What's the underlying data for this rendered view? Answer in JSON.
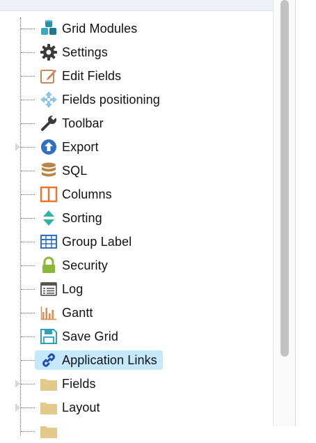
{
  "tree": {
    "items": [
      {
        "label": "Grid Modules",
        "icon": "cubes-icon",
        "expandable": false,
        "selected": false
      },
      {
        "label": "Settings",
        "icon": "gear-icon",
        "expandable": false,
        "selected": false
      },
      {
        "label": "Edit Fields",
        "icon": "edit-icon",
        "expandable": false,
        "selected": false
      },
      {
        "label": "Fields positioning",
        "icon": "move-arrows-icon",
        "expandable": false,
        "selected": false
      },
      {
        "label": "Toolbar",
        "icon": "wrench-icon",
        "expandable": false,
        "selected": false
      },
      {
        "label": "Export",
        "icon": "upload-icon",
        "expandable": true,
        "selected": false
      },
      {
        "label": "SQL",
        "icon": "database-icon",
        "expandable": false,
        "selected": false
      },
      {
        "label": "Columns",
        "icon": "columns-icon",
        "expandable": false,
        "selected": false
      },
      {
        "label": "Sorting",
        "icon": "sort-icon",
        "expandable": false,
        "selected": false
      },
      {
        "label": "Group Label",
        "icon": "table-grid-icon",
        "expandable": false,
        "selected": false
      },
      {
        "label": "Security",
        "icon": "lock-icon",
        "expandable": false,
        "selected": false
      },
      {
        "label": "Log",
        "icon": "log-list-icon",
        "expandable": false,
        "selected": false
      },
      {
        "label": "Gantt",
        "icon": "bar-chart-icon",
        "expandable": false,
        "selected": false
      },
      {
        "label": "Save Grid",
        "icon": "floppy-disk-icon",
        "expandable": false,
        "selected": false
      },
      {
        "label": "Application Links",
        "icon": "link-icon",
        "expandable": false,
        "selected": true
      },
      {
        "label": "Fields",
        "icon": "folder-icon",
        "expandable": true,
        "selected": false
      },
      {
        "label": "Layout",
        "icon": "folder-icon",
        "expandable": true,
        "selected": false
      }
    ]
  },
  "colors": {
    "selected_bg": "#c6e8fb",
    "folder": "#e3c98a",
    "teal": "#2fa0b7",
    "orange": "#e9742f",
    "green": "#8cb83a",
    "blue": "#2f6fc4"
  }
}
